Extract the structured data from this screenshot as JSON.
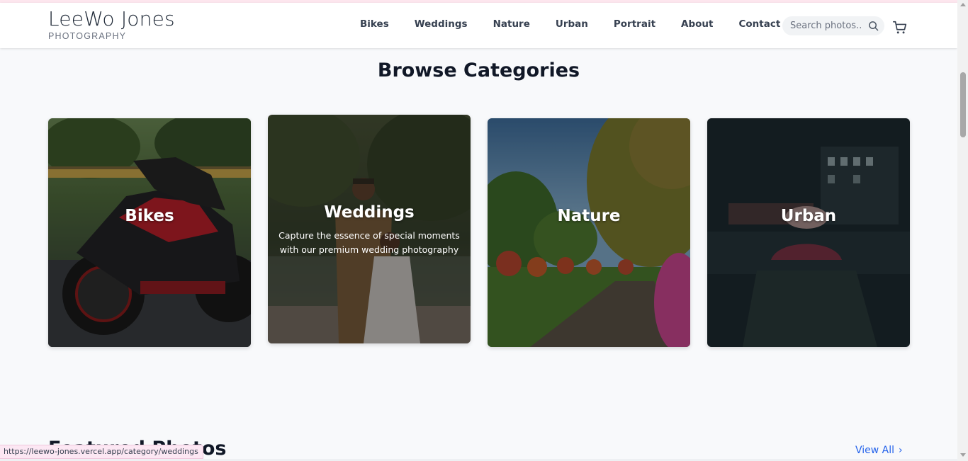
{
  "header": {
    "brand_name": "LeeWo Jones",
    "brand_sub": "PHOTOGRAPHY",
    "nav": [
      "Bikes",
      "Weddings",
      "Nature",
      "Urban",
      "Portrait",
      "About",
      "Contact"
    ],
    "search_placeholder": "Search photos...",
    "icons": {
      "search": "search-icon",
      "cart": "cart-icon"
    }
  },
  "categories_section": {
    "title": "Browse Categories",
    "cards": [
      {
        "label": "Bikes",
        "description": ""
      },
      {
        "label": "Weddings",
        "description": "Capture the essence of special moments with our premium wedding photography"
      },
      {
        "label": "Nature",
        "description": ""
      },
      {
        "label": "Urban",
        "description": ""
      }
    ]
  },
  "featured": {
    "title": "Featured Photos",
    "view_all": "View All"
  },
  "status_bar": {
    "url": "https://leewo-jones.vercel.app/category/weddings"
  },
  "colors": {
    "accent": "#2563eb",
    "background": "#f8f9fb",
    "text": "#111827"
  }
}
